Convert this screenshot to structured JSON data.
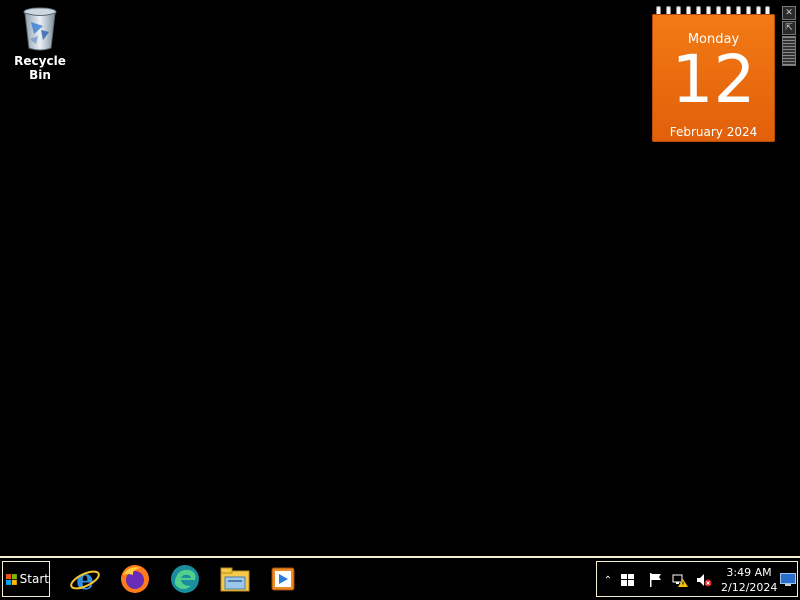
{
  "desktop": {
    "icons": [
      {
        "label": "Recycle Bin",
        "icon": "recycle-bin-icon"
      }
    ]
  },
  "calendar_gadget": {
    "day_name": "Monday",
    "day_number": "12",
    "month_year": "February 2024",
    "accent_color": "#ee6f0f"
  },
  "taskbar": {
    "start_label": "Start",
    "pinned": [
      {
        "name": "Internet Explorer",
        "icon": "internet-explorer-icon"
      },
      {
        "name": "Firefox",
        "icon": "firefox-icon"
      },
      {
        "name": "Edge",
        "icon": "edge-icon"
      },
      {
        "name": "File Explorer",
        "icon": "file-explorer-icon"
      },
      {
        "name": "Media Player",
        "icon": "media-player-icon"
      }
    ],
    "tray": {
      "time": "3:49 AM",
      "date": "2/12/2024"
    }
  }
}
